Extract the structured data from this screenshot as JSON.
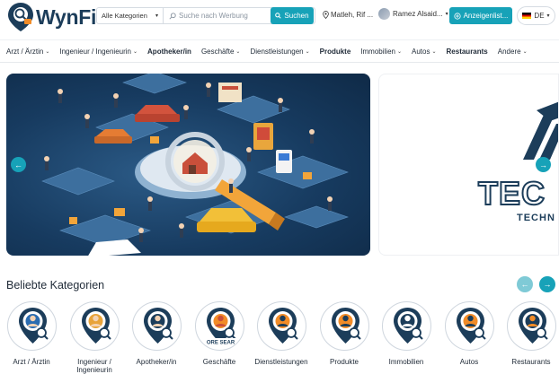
{
  "header": {
    "logo_text": "WynFi",
    "category_select": "Alle Kategorien",
    "search_placeholder": "Suche nach Werbung",
    "search_button": "Suchen",
    "location": "Matleh, Rif ...",
    "user_name": "Ramez Alsaid...",
    "post_button": "Anzeigenlist...",
    "language": "DE"
  },
  "nav": {
    "items": [
      {
        "label": "Arzt / Ärztin",
        "dropdown": true
      },
      {
        "label": "Ingenieur / Ingenieurin",
        "dropdown": true
      },
      {
        "label": "Apotheker/in",
        "dropdown": false
      },
      {
        "label": "Geschäfte",
        "dropdown": true
      },
      {
        "label": "Dienstleistungen",
        "dropdown": true
      },
      {
        "label": "Produkte",
        "dropdown": false
      },
      {
        "label": "Immobilien",
        "dropdown": true
      },
      {
        "label": "Autos",
        "dropdown": true
      },
      {
        "label": "Restaurants",
        "dropdown": false
      },
      {
        "label": "Andere",
        "dropdown": true
      }
    ]
  },
  "slider": {
    "second_slide_text_1": "TEC",
    "second_slide_text_2": "TECHN"
  },
  "categories": {
    "title": "Beliebte Kategorien",
    "items": [
      {
        "label": "Arzt / Ärztin",
        "icon": "doctor-icon"
      },
      {
        "label": "Ingenieur / Ingenieurin",
        "icon": "engineer-icon"
      },
      {
        "label": "Apotheker/in",
        "icon": "pharmacist-icon"
      },
      {
        "label": "Geschäfte",
        "icon": "shop-icon",
        "banner": "ORE SEAR"
      },
      {
        "label": "Dienstleistungen",
        "icon": "services-icon"
      },
      {
        "label": "Produkte",
        "icon": "products-icon"
      },
      {
        "label": "Immobilien",
        "icon": "real-estate-icon"
      },
      {
        "label": "Autos",
        "icon": "car-icon"
      },
      {
        "label": "Restaurants",
        "icon": "restaurant-icon"
      }
    ]
  },
  "colors": {
    "accent": "#17a2b8",
    "brand_dark": "#1c3d5a",
    "pin_orange": "#f28c28"
  }
}
